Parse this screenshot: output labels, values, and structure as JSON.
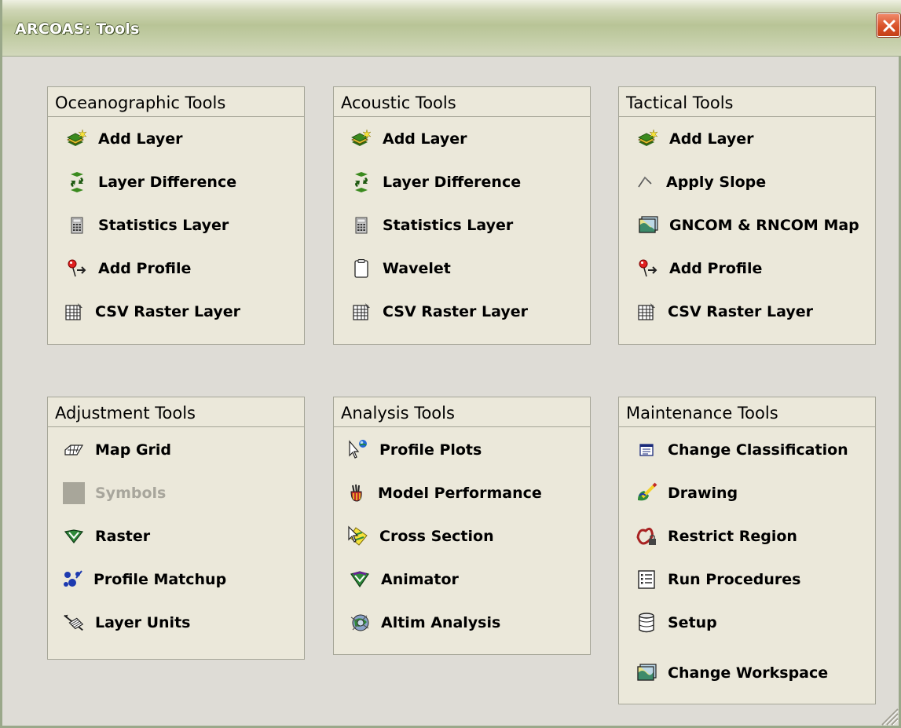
{
  "window": {
    "title": "ARCOAS:  Tools"
  },
  "groups": [
    {
      "title": "Oceanographic Tools",
      "items": [
        {
          "label": "Add Layer",
          "icon": "add-layer-icon"
        },
        {
          "label": "Layer Difference",
          "icon": "layer-difference-icon"
        },
        {
          "label": "Statistics Layer",
          "icon": "calculator-icon"
        },
        {
          "label": "Add Profile",
          "icon": "pushpin-icon"
        },
        {
          "label": "CSV Raster Layer",
          "icon": "csv-table-icon"
        }
      ]
    },
    {
      "title": "Acoustic Tools",
      "items": [
        {
          "label": "Add Layer",
          "icon": "add-layer-icon"
        },
        {
          "label": "Layer Difference",
          "icon": "layer-difference-icon"
        },
        {
          "label": "Statistics Layer",
          "icon": "calculator-icon"
        },
        {
          "label": "Wavelet",
          "icon": "clipboard-icon"
        },
        {
          "label": "CSV Raster Layer",
          "icon": "csv-table-icon"
        }
      ]
    },
    {
      "title": "Tactical Tools",
      "items": [
        {
          "label": "Add Layer",
          "icon": "add-layer-icon"
        },
        {
          "label": "Apply Slope",
          "icon": "slope-icon"
        },
        {
          "label": "GNCOM & RNCOM Map",
          "icon": "map-icon"
        },
        {
          "label": "Add Profile",
          "icon": "pushpin-icon"
        },
        {
          "label": "CSV Raster Layer",
          "icon": "csv-table-icon"
        }
      ]
    },
    {
      "title": "Adjustment Tools",
      "items": [
        {
          "label": "Map Grid",
          "icon": "map-grid-icon"
        },
        {
          "label": "Symbols",
          "icon": "symbols-icon",
          "disabled": true
        },
        {
          "label": "Raster",
          "icon": "raster-icon"
        },
        {
          "label": "Profile Matchup",
          "icon": "profile-matchup-icon"
        },
        {
          "label": "Layer Units",
          "icon": "layer-units-icon"
        }
      ]
    },
    {
      "title": "Analysis Tools",
      "items": [
        {
          "label": "Profile Plots",
          "icon": "profile-plots-icon"
        },
        {
          "label": "Model Performance",
          "icon": "model-performance-icon"
        },
        {
          "label": "Cross Section",
          "icon": "cross-section-icon"
        },
        {
          "label": "Animator",
          "icon": "animator-icon"
        },
        {
          "label": "Altim Analysis",
          "icon": "altim-analysis-icon"
        }
      ]
    },
    {
      "title": "Maintenance Tools",
      "items": [
        {
          "label": "Change Classification",
          "icon": "classification-icon"
        },
        {
          "label": "Drawing",
          "icon": "drawing-icon"
        },
        {
          "label": "Restrict Region",
          "icon": "restrict-region-icon"
        },
        {
          "label": "Run Procedures",
          "icon": "run-procedures-icon"
        },
        {
          "label": "Setup",
          "icon": "setup-database-icon"
        },
        {
          "label": "Change Workspace",
          "icon": "workspace-map-icon"
        }
      ]
    }
  ]
}
